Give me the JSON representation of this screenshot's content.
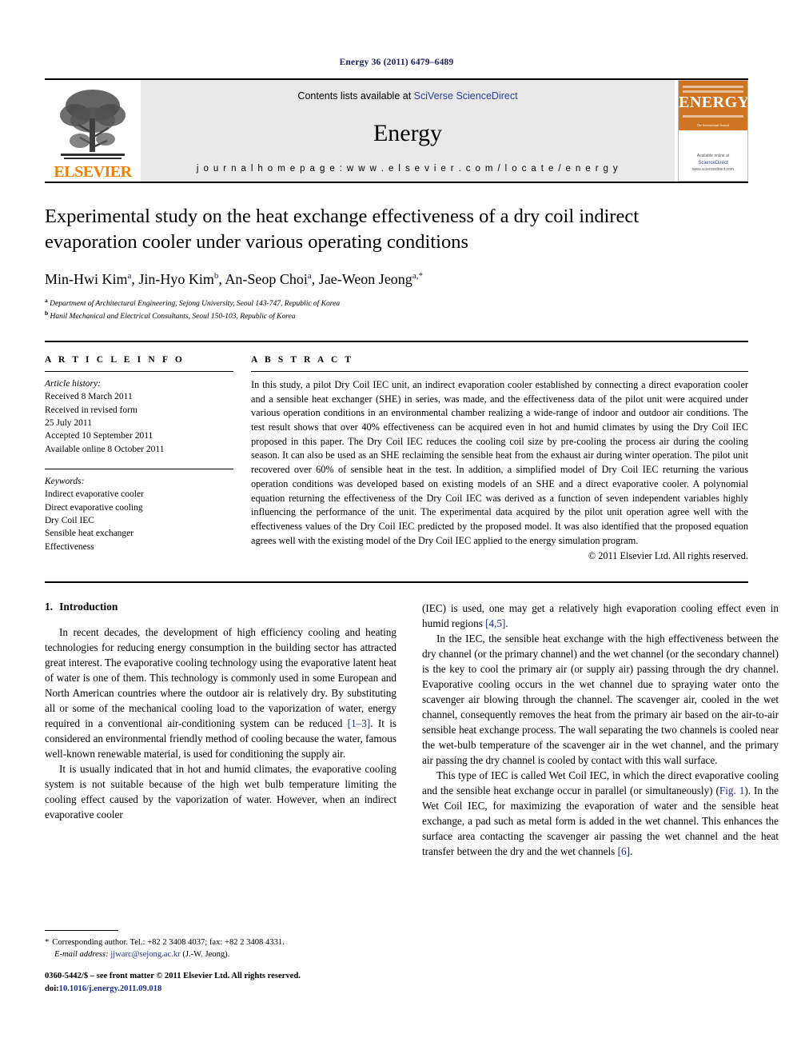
{
  "running_head": "Energy 36 (2011) 6479–6489",
  "masthead": {
    "publisher_name": "ELSEVIER",
    "contents_prefix": "Contents lists available at ",
    "contents_link": "SciVerse ScienceDirect",
    "journal_title": "Energy",
    "homepage": "j o u r n a l   h o m e p a g e :   w w w . e l s e v i e r . c o m / l o c a t e / e n e r g y",
    "cover": {
      "title": "ENERGY",
      "subtitle": "The International Journal",
      "footer_link": "ScienceDirect",
      "footer_note": "www.sciencedirect.com"
    }
  },
  "article": {
    "title": "Experimental study on the heat exchange effectiveness of a dry coil indirect evaporation cooler under various operating conditions",
    "authors_html": "Min-Hwi Kim <sup>a</sup>, Jin-Hyo Kim <sup>b</sup>, An-Seop Choi <sup>a</sup>, Jae-Weon Jeong <sup>a,∗</sup>",
    "affiliations": [
      {
        "mark": "a",
        "text": "Department of Architectural Engineering, Sejong University, Seoul 143-747, Republic of Korea"
      },
      {
        "mark": "b",
        "text": "Hanil Mechanical and Electrical Consultants, Seoul 150-103, Republic of Korea"
      }
    ]
  },
  "article_info": {
    "heading": "A R T I C L E   I N F O",
    "history_label": "Article history:",
    "history": [
      "Received 8 March 2011",
      "Received in revised form",
      "25 July 2011",
      "Accepted 10 September 2011",
      "Available online 8 October 2011"
    ],
    "keywords_label": "Keywords:",
    "keywords": [
      "Indirect evaporative cooler",
      "Direct evaporative cooling",
      "Dry Coil IEC",
      "Sensible heat exchanger",
      "Effectiveness"
    ]
  },
  "abstract": {
    "heading": "A B S T R A C T",
    "text": "In this study, a pilot Dry Coil IEC unit, an indirect evaporation cooler established by connecting a direct evaporation cooler and a sensible heat exchanger (SHE) in series, was made, and the effectiveness data of the pilot unit were acquired under various operation conditions in an environmental chamber realizing a wide-range of indoor and outdoor air conditions. The test result shows that over 40% effectiveness can be acquired even in hot and humid climates by using the Dry Coil IEC proposed in this paper. The Dry Coil IEC reduces the cooling coil size by pre-cooling the process air during the cooling season. It can also be used as an SHE reclaiming the sensible heat from the exhaust air during winter operation. The pilot unit recovered over 60% of sensible heat in the test. In addition, a simplified model of Dry Coil IEC returning the various operation conditions was developed based on existing models of an SHE and a direct evaporative cooler. A polynomial equation returning the effectiveness of the Dry Coil IEC was derived as a function of seven independent variables highly influencing the performance of the unit. The experimental data acquired by the pilot unit operation agree well with the effectiveness values of the Dry Coil IEC predicted by the proposed model. It was also identified that the proposed equation agrees well with the existing model of the Dry Coil IEC applied to the energy simulation program.",
    "copyright": "© 2011 Elsevier Ltd. All rights reserved."
  },
  "body": {
    "section_number": "1.",
    "section_title": "Introduction",
    "left_paragraphs": [
      "In recent decades, the development of high efficiency cooling and heating technologies for reducing energy consumption in the building sector has attracted great interest. The evaporative cooling technology using the evaporative latent heat of water is one of them. This technology is commonly used in some European and North American countries where the outdoor air is relatively dry. By substituting all or some of the mechanical cooling load to the vaporization of water, energy required in a conventional air-conditioning system can be reduced [1–3]. It is considered an environmental friendly method of cooling because the water, famous well-known renewable material, is used for conditioning the supply air.",
      "It is usually indicated that in hot and humid climates, the evaporative cooling system is not suitable because of the high wet bulb temperature limiting the cooling effect caused by the vaporization of water. However, when an indirect evaporative cooler"
    ],
    "right_paragraphs": [
      "(IEC) is used, one may get a relatively high evaporation cooling effect even in humid regions [4,5].",
      "In the IEC, the sensible heat exchange with the high effectiveness between the dry channel (or the primary channel) and the wet channel (or the secondary channel) is the key to cool the primary air (or supply air) passing through the dry channel. Evaporative cooling occurs in the wet channel due to spraying water onto the scavenger air blowing through the channel. The scavenger air, cooled in the wet channel, consequently removes the heat from the primary air based on the air-to-air sensible heat exchange process. The wall separating the two channels is cooled near the wet-bulb temperature of the scavenger air in the wet channel, and the primary air passing the dry channel is cooled by contact with this wall surface.",
      "This type of IEC is called Wet Coil IEC, in which the direct evaporative cooling and the sensible heat exchange occur in parallel (or simultaneously) (Fig. 1). In the Wet Coil IEC, for maximizing the evaporation of water and the sensible heat exchange, a pad such as metal form is added in the wet channel. This enhances the surface area contacting the scavenger air passing the wet channel and the heat transfer between the dry and the wet channels [6]."
    ]
  },
  "footnote": {
    "star": "*",
    "corresponding": "Corresponding author. Tel.: +82 2 3408 4037; fax: +82 2 3408 4331.",
    "email_label": "E-mail address:",
    "email": "jjwarc@sejong.ac.kr",
    "email_owner": "(J.-W. Jeong)."
  },
  "footer": {
    "issn_line": "0360-5442/$ – see front matter © 2011 Elsevier Ltd. All rights reserved.",
    "doi_label": "doi:",
    "doi_value": "10.1016/j.energy.2011.09.018"
  },
  "colors": {
    "link_blue": "#2b3fa0",
    "ref_blue": "#1b2f8f",
    "elsevier_orange": "#f08000",
    "cover_orange": "#cf7420",
    "masthead_gray": "#e8e8e8"
  }
}
